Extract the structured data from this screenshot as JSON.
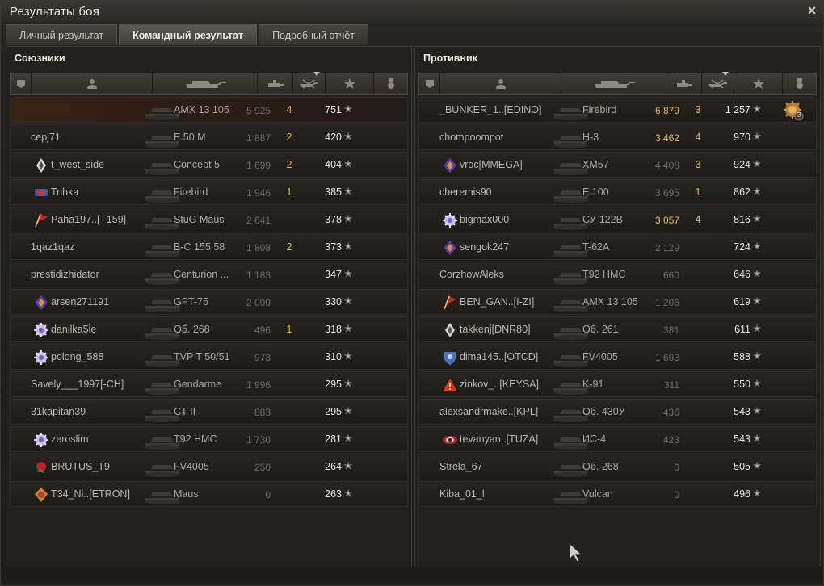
{
  "window": {
    "title": "Результаты боя",
    "close_icon": "×"
  },
  "tabs": [
    {
      "label": "Личный результат",
      "active": false
    },
    {
      "label": "Командный результат",
      "active": true
    },
    {
      "label": "Подробный отчёт",
      "active": false
    }
  ],
  "columns": [
    "squad-icon",
    "player-icon",
    "tank-icon",
    "damage-icon",
    "kills-icon",
    "experience-star-icon",
    "medal-icon"
  ],
  "allies": {
    "title": "Союзники",
    "rows": [
      {
        "player": "",
        "badge": "",
        "tank": "AMX 13 105",
        "damage": "5 925",
        "kills": "4",
        "xp": "751",
        "self": true,
        "dmg_hi": false
      },
      {
        "player": "cepj71",
        "badge": "",
        "tank": "E 50 M",
        "damage": "1 887",
        "kills": "2",
        "xp": "420"
      },
      {
        "player": "t_west_side",
        "badge": "diamond",
        "tank": "Concept 5",
        "damage": "1 699",
        "kills": "2",
        "xp": "404"
      },
      {
        "player": "Trihka",
        "badge": "flag",
        "tank": "Firebird",
        "damage": "1 946",
        "kills": "1",
        "xp": "385"
      },
      {
        "player": "Paha197..[--159]",
        "badge": "banner",
        "tank": "StuG Maus",
        "damage": "2 641",
        "kills": "",
        "xp": "378"
      },
      {
        "player": "1qaz1qaz",
        "badge": "",
        "tank": "B-C 155 58",
        "damage": "1 808",
        "kills": "2",
        "xp": "373"
      },
      {
        "player": "prestidizhidator",
        "badge": "",
        "tank": "Centurion ...",
        "damage": "1 183",
        "kills": "",
        "xp": "347"
      },
      {
        "player": "arsen271191",
        "badge": "pennant",
        "tank": "GPT-75",
        "damage": "2 000",
        "kills": "",
        "xp": "330"
      },
      {
        "player": "danilka5le",
        "badge": "gear",
        "tank": "Об. 268",
        "damage": "496",
        "kills": "1",
        "xp": "318"
      },
      {
        "player": "polong_588",
        "badge": "gear",
        "tank": "TVP T 50/51",
        "damage": "973",
        "kills": "",
        "xp": "310"
      },
      {
        "player": "Savely___1997[-CH]",
        "badge": "",
        "tank": "Gendarme",
        "damage": "1 996",
        "kills": "",
        "xp": "295"
      },
      {
        "player": "31kapitan39",
        "badge": "",
        "tank": "CT-II",
        "damage": "883",
        "kills": "",
        "xp": "295"
      },
      {
        "player": "zeroslim",
        "badge": "gear",
        "tank": "T92 HMC",
        "damage": "1 730",
        "kills": "",
        "xp": "281"
      },
      {
        "player": "BRUTUS_T9",
        "badge": "rose",
        "tank": "FV4005",
        "damage": "250",
        "kills": "",
        "xp": "264"
      },
      {
        "player": "T34_Ni..[ETRON]",
        "badge": "crest",
        "tank": "Maus",
        "damage": "0",
        "kills": "",
        "xp": "263"
      }
    ]
  },
  "enemies": {
    "title": "Противник",
    "rows": [
      {
        "player": "_BUNKER_1..[EDINO]",
        "badge": "",
        "tank": "Firebird",
        "damage": "6 879",
        "kills": "3",
        "xp": "1 257",
        "dmg_hi": true,
        "medal": "3"
      },
      {
        "player": "chompoompot",
        "badge": "",
        "tank": "Н-3",
        "damage": "3 462",
        "kills": "4",
        "xp": "970",
        "dmg_hi": true
      },
      {
        "player": "vroc[MMEGA]",
        "badge": "pennant",
        "tank": "XM57",
        "damage": "4 408",
        "kills": "3",
        "xp": "924"
      },
      {
        "player": "cheremis90",
        "badge": "",
        "tank": "E 100",
        "damage": "3 695",
        "kills": "1",
        "xp": "862"
      },
      {
        "player": "bigmax000",
        "badge": "gear",
        "tank": "СУ-122В",
        "damage": "3 057",
        "kills": "4",
        "xp": "816",
        "dmg_hi": true
      },
      {
        "player": "sengok247",
        "badge": "pennant",
        "tank": "T-62A",
        "damage": "2 129",
        "kills": "",
        "xp": "724"
      },
      {
        "player": "CorzhowAleks",
        "badge": "",
        "tank": "T92 HMC",
        "damage": "660",
        "kills": "",
        "xp": "646"
      },
      {
        "player": "BEN_GAN..[I-ZI]",
        "badge": "banner",
        "tank": "AMX 13 105",
        "damage": "1 206",
        "kills": "",
        "xp": "619"
      },
      {
        "player": "takkenj[DNR80]",
        "badge": "diamond",
        "tank": "Об. 261",
        "damage": "381",
        "kills": "",
        "xp": "611"
      },
      {
        "player": "dima145..[OTCD]",
        "badge": "shield",
        "tank": "FV4005",
        "damage": "1 693",
        "kills": "",
        "xp": "588"
      },
      {
        "player": "zinkov_..[KEYSA]",
        "badge": "warning",
        "tank": "K-91",
        "damage": "311",
        "kills": "",
        "xp": "550"
      },
      {
        "player": "alexsandrmake..[KPL]",
        "badge": "",
        "tank": "Об. 430У",
        "damage": "436",
        "kills": "",
        "xp": "543"
      },
      {
        "player": "tevanyan..[TUZA]",
        "badge": "eye",
        "tank": "ИС-4",
        "damage": "423",
        "kills": "",
        "xp": "543"
      },
      {
        "player": "Strela_67",
        "badge": "",
        "tank": "Об. 268",
        "damage": "0",
        "kills": "",
        "xp": "505"
      },
      {
        "player": "Kiba_01_l",
        "badge": "",
        "tank": "Vulcan",
        "damage": "0",
        "kills": "",
        "xp": "496"
      }
    ]
  },
  "star_glyph": "✭",
  "colors": {
    "kills": "#e3b764",
    "self_row": "#3b2318",
    "accent_damage": "#e3b764"
  }
}
